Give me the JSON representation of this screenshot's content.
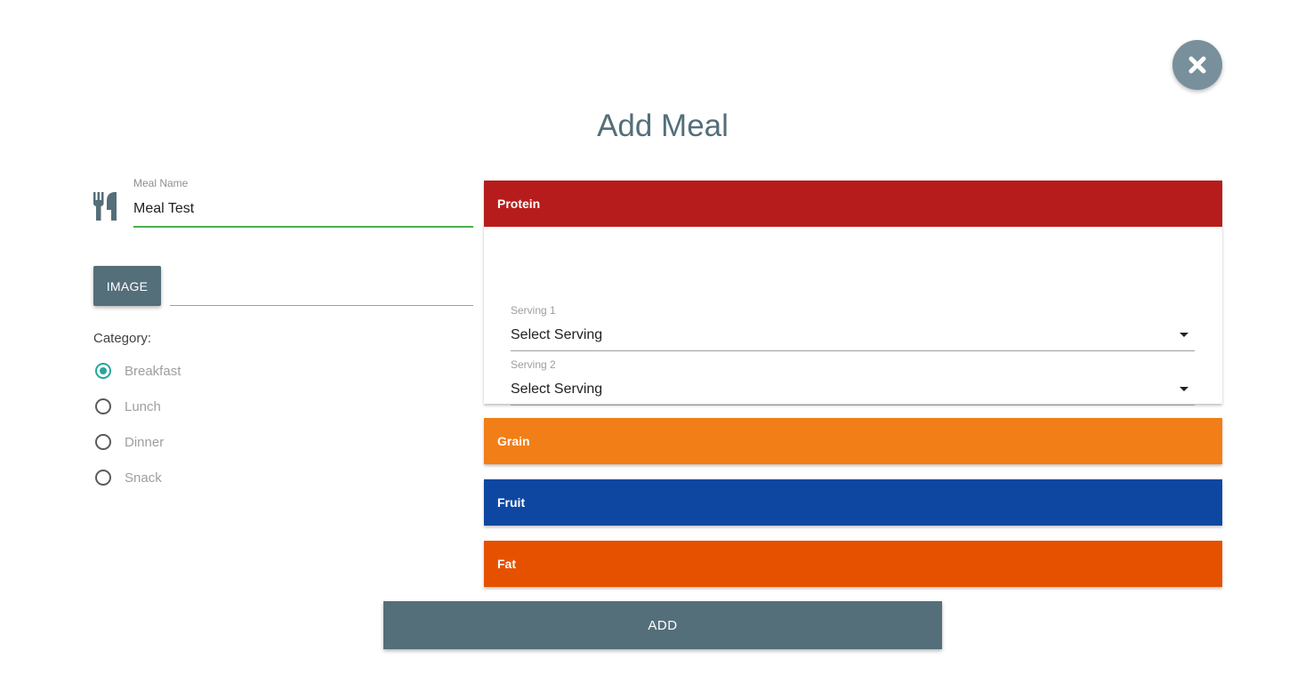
{
  "title": "Add Meal",
  "close_button": {
    "icon": "close-icon"
  },
  "meal_name": {
    "label": "Meal Name",
    "value": "Meal Test",
    "icon": "utensils-icon"
  },
  "image": {
    "button_label": "IMAGE",
    "path_value": ""
  },
  "category": {
    "label": "Category:",
    "options": [
      "Breakfast",
      "Lunch",
      "Dinner",
      "Snack"
    ],
    "selected": "Breakfast"
  },
  "groups": [
    {
      "name": "Protein",
      "color": "#b71c1c",
      "expanded": true,
      "servings": [
        {
          "label": "Serving 1",
          "value": "Select Serving"
        },
        {
          "label": "Serving 2",
          "value": "Select Serving"
        }
      ]
    },
    {
      "name": "Grain",
      "color": "#f27e17",
      "expanded": false
    },
    {
      "name": "Fruit",
      "color": "#0d47a1",
      "expanded": false
    },
    {
      "name": "Fat",
      "color": "#e65100",
      "expanded": false
    }
  ],
  "add_button": {
    "label": "ADD"
  },
  "colors": {
    "primary": "#546e7a",
    "close_button": "#78909c",
    "radio_checked": "#26a69a",
    "input_focus": "#4caf50"
  }
}
